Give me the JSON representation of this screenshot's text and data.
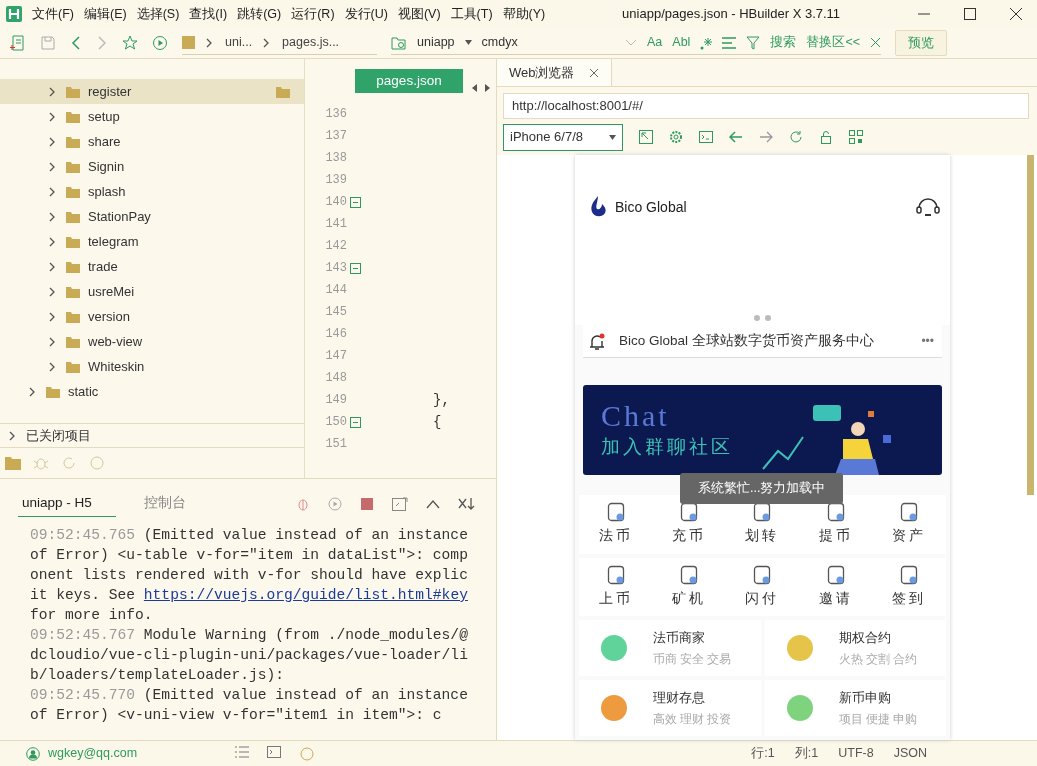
{
  "window": {
    "title": "uniapp/pages.json - HBuilder X 3.7.11"
  },
  "menu": [
    "文件(F)",
    "编辑(E)",
    "选择(S)",
    "查找(I)",
    "跳转(G)",
    "运行(R)",
    "发行(U)",
    "视图(V)",
    "工具(T)",
    "帮助(Y)"
  ],
  "breadcrumb": [
    "uni...",
    "pages.js..."
  ],
  "search": {
    "project": "uniapp",
    "value": "cmdyx",
    "options": [
      "Aa",
      "Abl"
    ],
    "search_label": "搜索",
    "replace_label": "替换区<<",
    "preview_label": "预览"
  },
  "tree": [
    {
      "children": [
        {
          "label": "register",
          "selected": true
        },
        {
          "label": "setup",
          "selected": false
        },
        {
          "label": "share",
          "selected": false
        },
        {
          "label": "Signin",
          "selected": false
        },
        {
          "label": "splash",
          "selected": false
        },
        {
          "label": "StationPay",
          "selected": false
        },
        {
          "label": "telegram",
          "selected": false
        },
        {
          "label": "trade",
          "selected": false
        },
        {
          "label": "usreMei",
          "selected": false
        },
        {
          "label": "version",
          "selected": false
        },
        {
          "label": "web-view",
          "selected": false
        },
        {
          "label": "Whiteskin",
          "selected": false
        }
      ]
    },
    {
      "label": "static",
      "selected": false
    }
  ],
  "closed_projects": "已关闭项目",
  "editor": {
    "tab": "pages.json",
    "lines": [
      {
        "number": "136",
        "fold": false
      },
      {
        "number": "137",
        "fold": false
      },
      {
        "number": "138",
        "fold": false
      },
      {
        "number": "139",
        "fold": false
      },
      {
        "number": "140",
        "fold": true
      },
      {
        "number": "141",
        "fold": false
      },
      {
        "number": "142",
        "fold": false
      },
      {
        "number": "143",
        "fold": true
      },
      {
        "number": "144",
        "fold": false
      },
      {
        "number": "145",
        "fold": false
      },
      {
        "number": "146",
        "fold": false
      },
      {
        "number": "147",
        "fold": false
      },
      {
        "number": "148",
        "fold": false
      },
      {
        "number": "149",
        "fold": false,
        "code": "},"
      },
      {
        "number": "150",
        "fold": true,
        "code": "{"
      },
      {
        "number": "151",
        "fold": false
      }
    ]
  },
  "console": {
    "tabs": [
      {
        "label": "uniapp - H5",
        "selected": true
      },
      {
        "label": "控制台",
        "selected": false
      }
    ],
    "entries": [
      {
        "time": "09:52:45.765",
        "text": "(Emitted value instead of an instance of Error) <u-table v-for=\"item in dataList\">: component lists rendered with v-for should have explicit keys. See ",
        "link": "https://vuejs.org/guide/list.html#key",
        "tail": " for more info."
      },
      {
        "time": "09:52:45.767",
        "text": "Module Warning (from ./node_modules/@dcloudio/vue-cli-plugin-uni/packages/vue-loader/lib/loaders/templateLoader.js):"
      },
      {
        "time": "09:52:45.770",
        "text": "(Emitted value instead of an instance of Error) <v-uni-view v-for=\"item1 in item\">: c"
      }
    ]
  },
  "browser": {
    "tab": "Web浏览器",
    "url": "http://localhost:8001/#/",
    "device": "iPhone 6/7/8"
  },
  "phone": {
    "brand": "Bico Global",
    "notice": "Bico Global 全球站数字货币资产服务中心",
    "more": "•••",
    "banner": {
      "title": "Chat",
      "subtitle": "加入群聊社区"
    },
    "toast": "系统繁忙...努力加载中",
    "actions": [
      [
        "法币",
        "充币",
        "划转",
        "提币",
        "资产"
      ],
      [
        "上币",
        "矿机",
        "闪付",
        "邀请",
        "签到"
      ]
    ],
    "cards": [
      {
        "title": "法币商家",
        "subtitle": "币商 安全 交易",
        "color": "#5fd39a"
      },
      {
        "title": "期权合约",
        "subtitle": "火热 交割 合约",
        "color": "#e6c44a"
      },
      {
        "title": "理财存息",
        "subtitle": "高效 理财 投资",
        "color": "#ee9a3e"
      },
      {
        "title": "新币申购",
        "subtitle": "项目 便捷 申购",
        "color": "#7fd37f"
      }
    ]
  },
  "status_bar": {
    "user": "wgkey@qq.com",
    "line": "行:1",
    "column": "列:1",
    "encoding": "UTF-8",
    "language": "JSON"
  }
}
